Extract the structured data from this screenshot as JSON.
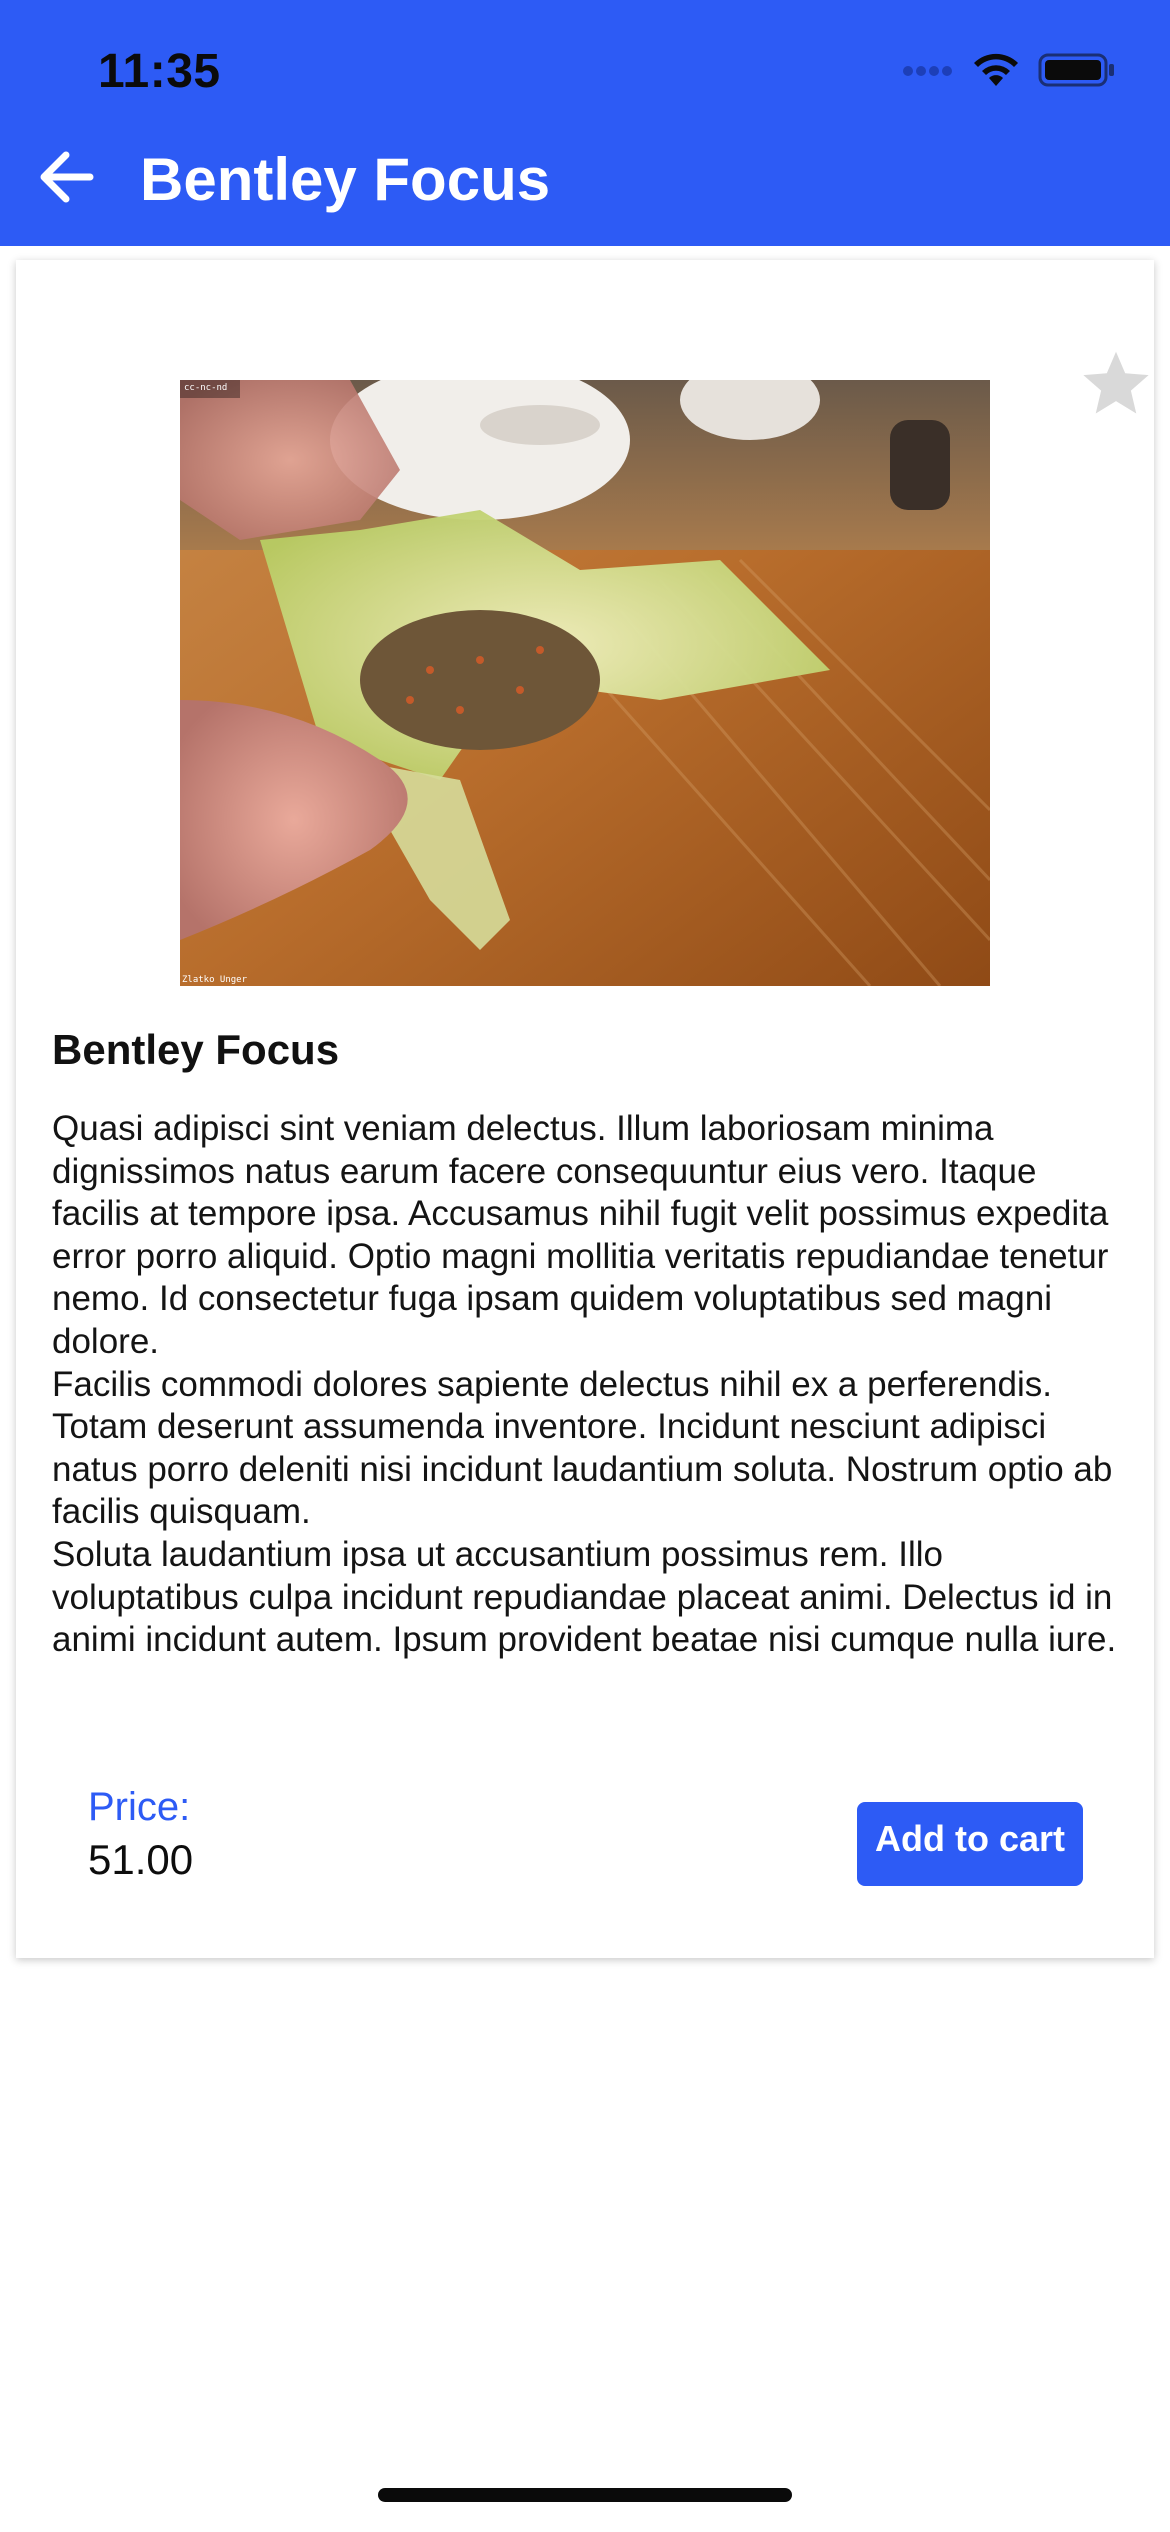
{
  "status_bar": {
    "time": "11:35",
    "icons": [
      "signal-dots-icon",
      "wifi-icon",
      "battery-icon"
    ]
  },
  "app_bar": {
    "back_icon": "arrow-left-icon",
    "title": "Bentley Focus",
    "background_color": "#2d5bf5"
  },
  "product": {
    "image_caption_top": "cc-nc-nd",
    "image_caption_bottom": "Zlatko Unger",
    "favorite_icon": "star-icon",
    "name": "Bentley Focus",
    "description": "Quasi adipisci sint veniam delectus. Illum laboriosam minima dignissimos natus earum facere consequuntur eius vero. Itaque facilis at tempore ipsa. Accusamus nihil fugit velit possimus expedita error porro aliquid. Optio magni mollitia veritatis repudiandae tenetur nemo. Id consectetur fuga ipsam quidem voluptatibus sed magni dolore.\nFacilis commodi dolores sapiente delectus nihil ex a perferendis. Totam deserunt assumenda inventore. Incidunt nesciunt adipisci natus porro deleniti nisi incidunt laudantium soluta. Nostrum optio ab facilis quisquam.\nSoluta laudantium ipsa ut accusantium possimus rem. Illo voluptatibus culpa incidunt repudiandae placeat animi. Delectus id in animi incidunt autem. Ipsum provident beatae nisi cumque nulla iure.",
    "price_label": "Price:",
    "price": "51.00",
    "add_to_cart_label": "Add to cart"
  },
  "colors": {
    "accent": "#2d5bf5",
    "star_inactive": "#d9d9d9"
  }
}
